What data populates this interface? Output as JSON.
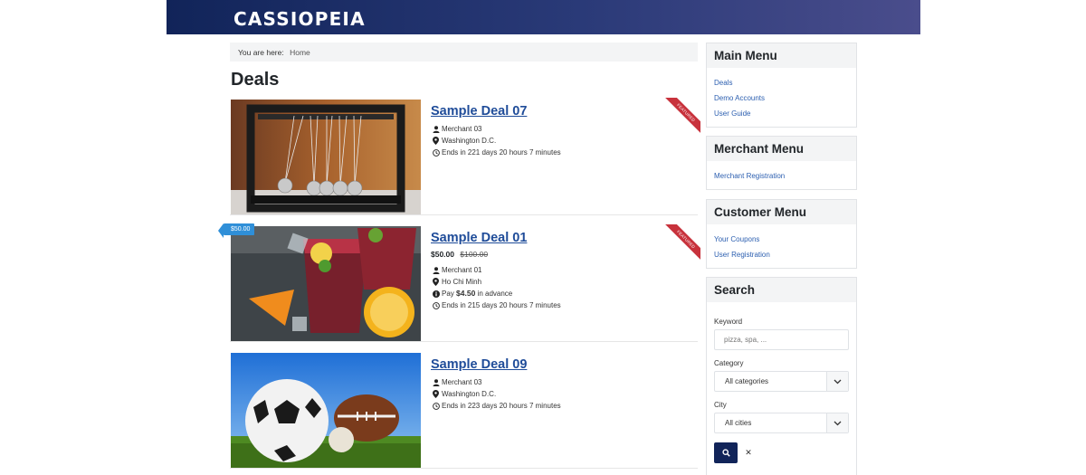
{
  "header": {
    "brand": "CASSIOPEIA"
  },
  "breadcrumb": {
    "prefix": "You are here:",
    "items": [
      "Home"
    ]
  },
  "page": {
    "title": "Deals"
  },
  "deals": [
    {
      "title": "Sample Deal 07",
      "ribbon": "FEATURED",
      "merchant": "Merchant 03",
      "location": "Washington D.C.",
      "ends": "Ends in 221 days 20 hours 7 minutes"
    },
    {
      "title": "Sample Deal 01",
      "ribbon": "FEATURED",
      "badge": "$50.00",
      "price_now": "$50.00",
      "price_old": "$100.00",
      "merchant": "Merchant 01",
      "location": "Ho Chi Minh",
      "pay_prefix": "Pay",
      "pay_amount": "$4.50",
      "pay_suffix": "in advance",
      "ends": "Ends in 215 days 20 hours 7 minutes"
    },
    {
      "title": "Sample Deal 09",
      "merchant": "Merchant 03",
      "location": "Washington D.C.",
      "ends": "Ends in 223 days 20 hours 7 minutes"
    }
  ],
  "sidebar": {
    "main_menu": {
      "title": "Main Menu",
      "links": [
        "Deals",
        "Demo Accounts",
        "User Guide"
      ]
    },
    "merchant_menu": {
      "title": "Merchant Menu",
      "links": [
        "Merchant Registration"
      ]
    },
    "customer_menu": {
      "title": "Customer Menu",
      "links": [
        "Your Coupons",
        "User Registration"
      ]
    },
    "search": {
      "title": "Search",
      "keyword_label": "Keyword",
      "keyword_placeholder": "pizza, spa, ...",
      "category_label": "Category",
      "category_value": "All categories",
      "city_label": "City",
      "city_value": "All cities",
      "clear_label": "✕"
    }
  },
  "colors": {
    "header": "#112459",
    "link": "#1f4c99",
    "ribbon": "#c8323c",
    "badge": "#2f8fd8"
  },
  "icons": [
    "user-icon",
    "map-marker-icon",
    "clock-icon",
    "info-circle-icon",
    "search-icon",
    "chevron-down-icon",
    "close-icon"
  ]
}
